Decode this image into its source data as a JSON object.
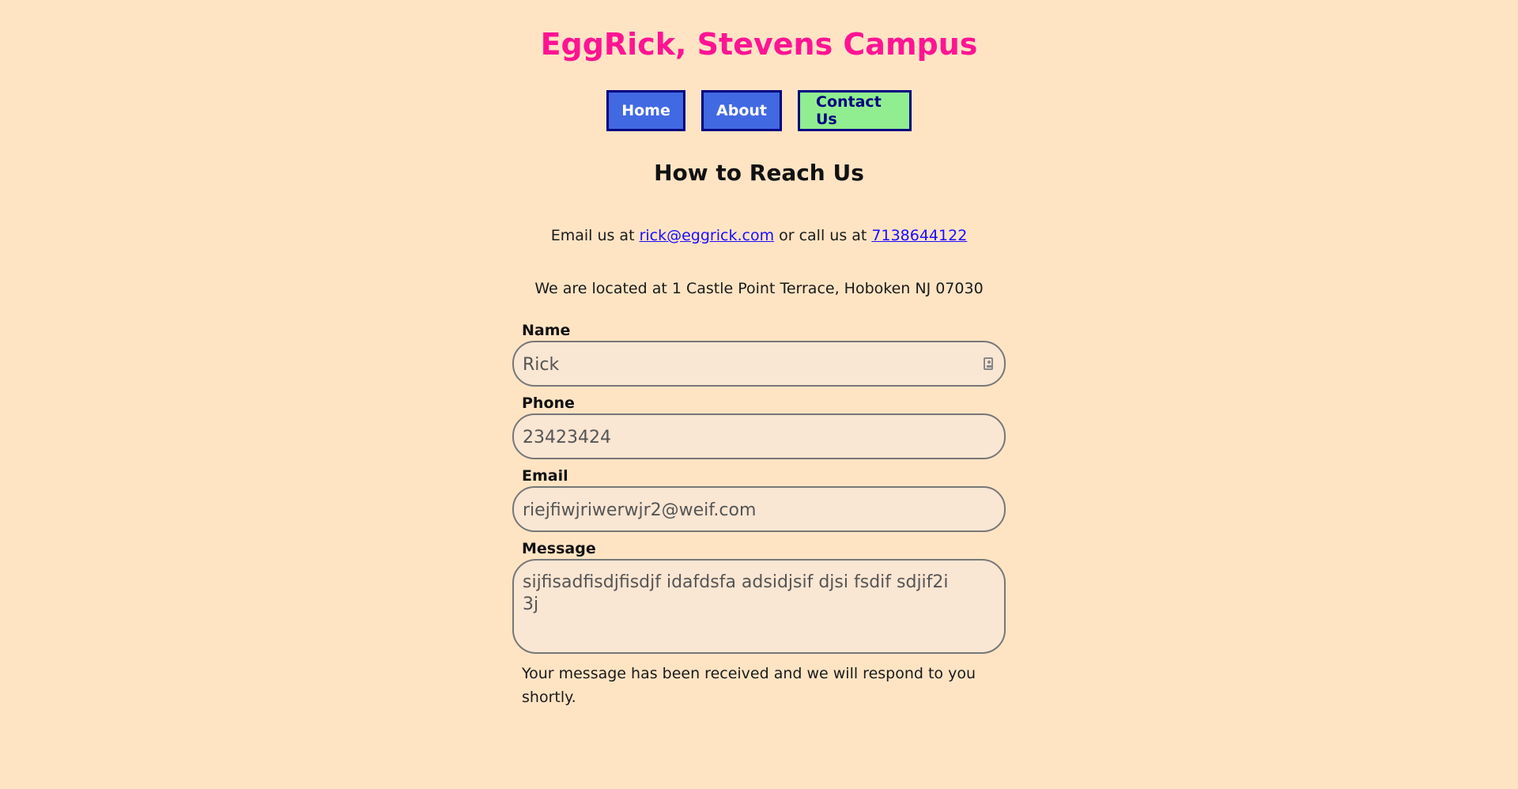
{
  "header": {
    "title": "EggRick, Stevens Campus"
  },
  "nav": {
    "home": "Home",
    "about": "About",
    "contact": "Contact Us"
  },
  "main": {
    "heading": "How to Reach Us",
    "contact_prefix": "Email us at ",
    "email_link": "rick@eggrick.com",
    "contact_middle": " or call us at ",
    "phone_link": "7138644122",
    "address": "We are located at 1 Castle Point Terrace, Hoboken NJ 07030"
  },
  "form": {
    "name_label": "Name",
    "name_value": "Rick",
    "phone_label": "Phone",
    "phone_value": "23423424",
    "email_label": "Email",
    "email_value": "riejfiwjriwerwjr2@weif.com",
    "message_label": "Message",
    "message_value": "sijfisadfisdjfisdjf idafdsfa adsidjsif djsi fsdif sdjif2i 3j",
    "status": "Your message has been received and we will respond to you shortly."
  },
  "colors": {
    "background": "#ffe4c4",
    "title": "#ff1493",
    "nav_button": "#4169e1",
    "nav_active": "#90ee90",
    "nav_border": "#000080",
    "link": "#1a0dff"
  },
  "icons": {
    "name_field_icon": "contact-card-icon"
  }
}
